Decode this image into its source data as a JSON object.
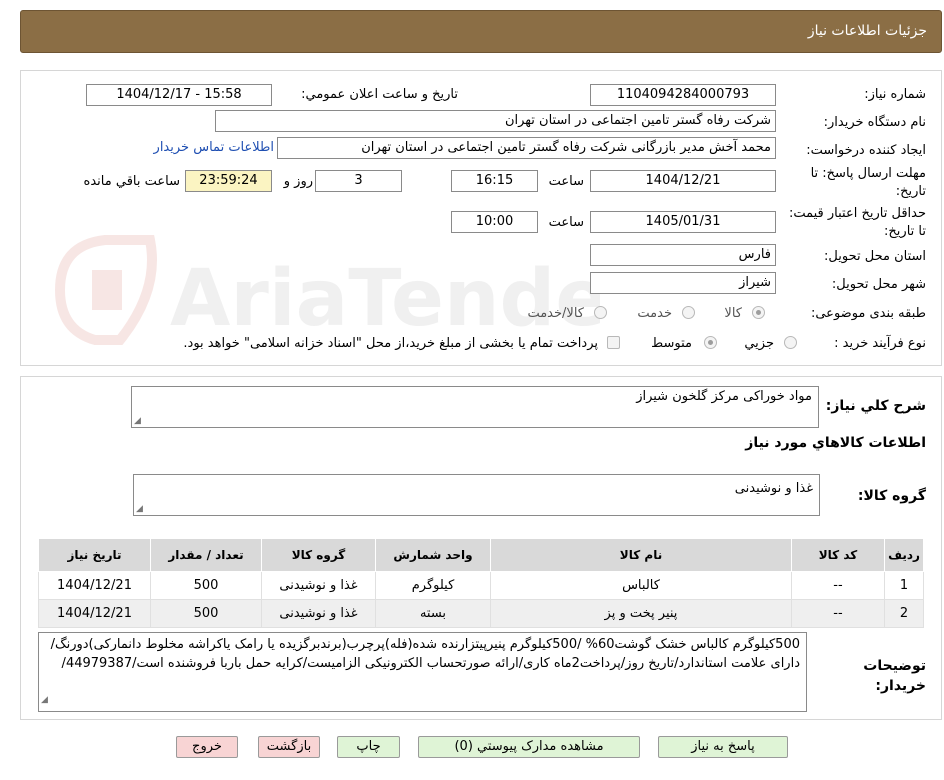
{
  "header": {
    "title": "جزئیات اطلاعات نیاز"
  },
  "form": {
    "need_number_label": "شماره نیاز:",
    "need_number": "1104094284000793",
    "announce_label": "تاریخ و ساعت اعلان عمومي:",
    "announce_value": "1404/12/17 - 15:58",
    "buyer_org_label": "نام دستگاه خریدار:",
    "buyer_org": "شرکت رفاه گستر تامین اجتماعی در استان تهران",
    "requester_label": "ایجاد کننده درخواست:",
    "requester": "محمد آخش مدیر بازرگانی شرکت رفاه گستر تامین اجتماعی در استان تهران",
    "contact_link": "اطلاعات تماس خریدار",
    "deadline_label": "مهلت ارسال پاسخ: تا تاریخ:",
    "deadline_date": "1404/12/21",
    "time_word": "ساعت",
    "deadline_time": "16:15",
    "days_value": "3",
    "days_word": "روز و",
    "remaining_time": "23:59:24",
    "remaining_word": "ساعت باقي مانده",
    "validity_label": "حداقل تاریخ اعتبار قیمت: تا تاریخ:",
    "validity_date": "1405/01/31",
    "validity_time": "10:00",
    "province_label": "استان محل تحویل:",
    "province": "فارس",
    "city_label": "شهر محل تحویل:",
    "city": "شیراز",
    "category_label": "طبقه بندی موضوعی:",
    "category_options": [
      "کالا",
      "خدمت",
      "کالا/خدمت"
    ],
    "process_label": "نوع فرآیند خرید :",
    "process_options": [
      "جزیي",
      "متوسط"
    ],
    "payment_note": "پرداخت تمام یا بخشی از مبلغ خرید،از محل \"اسناد خزانه اسلامی\" خواهد بود."
  },
  "summary": {
    "label": "شرح كلي نياز:",
    "value": "مواد خوراکی مرکز گلخون شیراز",
    "items_heading": "اطلاعات کالاهاي مورد نياز",
    "group_label": "گروه کالا:",
    "group_value": "غذا و نوشیدنی"
  },
  "table": {
    "headers": [
      "رديف",
      "کد کالا",
      "نام کالا",
      "واحد شمارش",
      "گروه کالا",
      "تعداد / مقدار",
      "تاريخ نياز"
    ],
    "rows": [
      [
        "1",
        "--",
        "کالباس",
        "کیلوگرم",
        "غذا و نوشیدنی",
        "500",
        "1404/12/21"
      ],
      [
        "2",
        "--",
        "پنیر پخت و پز",
        "بسته",
        "غذا و نوشیدنی",
        "500",
        "1404/12/21"
      ]
    ]
  },
  "notes": {
    "label": "توضیحات خریدار:",
    "value": "500کیلوگرم کالباس خشک گوشت60% /500کیلوگرم پنیرپیتزارنده شده(فله)پرچرب(برندبرگزیده یا رامک یاکراشه مخلوط دانمارکی)دورنگ/دارای علامت استاندارد/تاریخ روز/پرداخت2ماه کاری/ارائه صورتحساب الکترونیکی الزامیست/کرایه حمل باربا فروشنده است/44979387/"
  },
  "buttons": {
    "reply": "پاسخ به نیاز",
    "attachments": "مشاهده مدارک پیوستي (0)",
    "print": "چاپ",
    "back": "بازگشت",
    "exit": "خروج"
  },
  "watermark": {
    "text": "AriaTender.neT"
  },
  "colors": {
    "header_bg": "#8b6e45",
    "timer_bg": "#fbf4c2",
    "link": "#1f4fb2",
    "green_btn": "#dff4d6",
    "pink_btn": "#f8d4d4"
  }
}
